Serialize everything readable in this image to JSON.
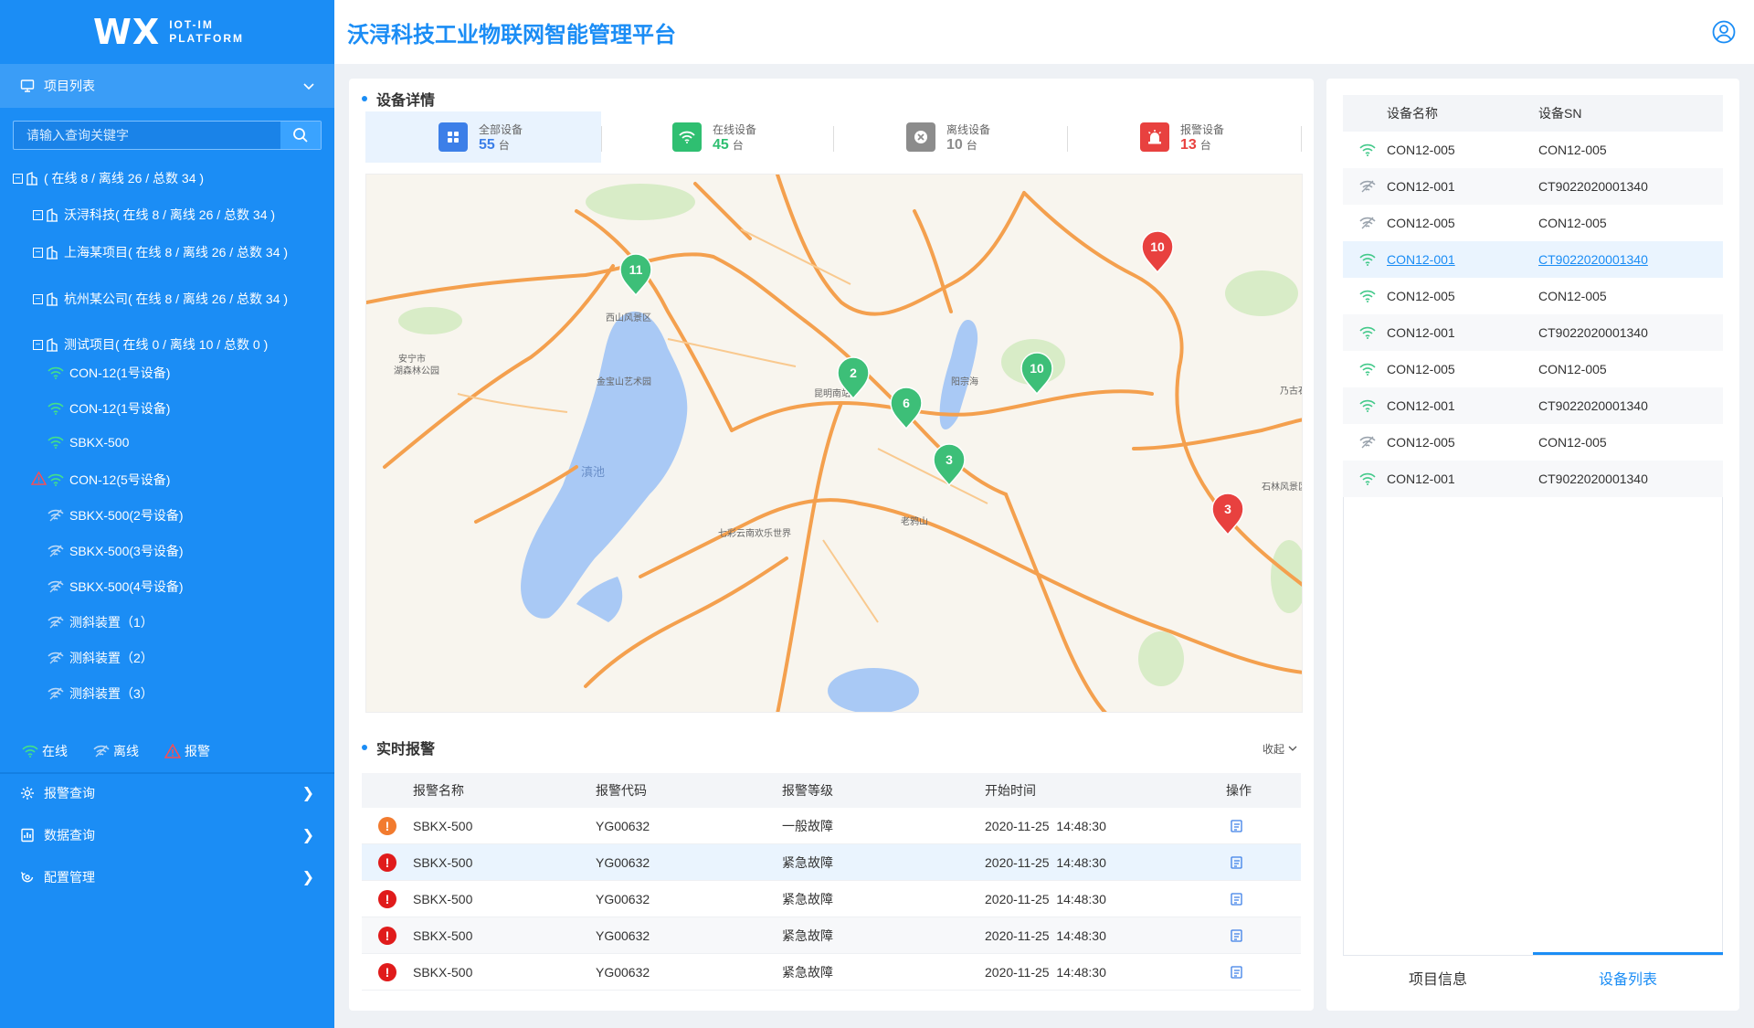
{
  "brand": {
    "logo": "WX",
    "sub_line1": "IOT-IM",
    "sub_line2": "PLATFORM"
  },
  "app_title": "沃浔科技工业物联网智能管理平台",
  "sidebar": {
    "project_menu": "项目列表",
    "search_placeholder": "请输入查询关键字",
    "tree": [
      {
        "label": "( 在线 8 / 离线 26 / 总数 34 )"
      },
      {
        "label": "沃浔科技( 在线 8 / 离线 26 / 总数 34 )"
      },
      {
        "label": "上海某项目( 在线 8 / 离线 26 / 总数 34 )"
      },
      {
        "label": "杭州某公司( 在线 8 / 离线 26 / 总数 34 )"
      },
      {
        "label": "测试项目( 在线 0 / 离线 10 / 总数 0 )"
      }
    ],
    "devices": [
      {
        "label": "CON-12(1号设备)",
        "status": "online",
        "alarm": false
      },
      {
        "label": "CON-12(1号设备)",
        "status": "online",
        "alarm": false
      },
      {
        "label": "SBKX-500",
        "status": "online",
        "alarm": false
      },
      {
        "label": "CON-12(5号设备)",
        "status": "online",
        "alarm": true
      },
      {
        "label": "SBKX-500(2号设备)",
        "status": "offline",
        "alarm": false
      },
      {
        "label": "SBKX-500(3号设备)",
        "status": "offline",
        "alarm": false
      },
      {
        "label": "SBKX-500(4号设备)",
        "status": "offline",
        "alarm": false
      },
      {
        "label": "测斜装置（1）",
        "status": "offline",
        "alarm": false
      },
      {
        "label": "测斜装置（2）",
        "status": "offline",
        "alarm": false
      },
      {
        "label": "测斜装置（3）",
        "status": "offline",
        "alarm": false
      }
    ],
    "legend": {
      "online": "在线",
      "offline": "离线",
      "alarm": "报警"
    },
    "nav": [
      {
        "label": "报警查询"
      },
      {
        "label": "数据查询"
      },
      {
        "label": "配置管理"
      }
    ]
  },
  "device_detail": {
    "title": "设备详情",
    "stats": [
      {
        "label": "全部设备",
        "value": "55",
        "unit": "台",
        "color": "#3c7fe8"
      },
      {
        "label": "在线设备",
        "value": "45",
        "unit": "台",
        "color": "#2fbf71"
      },
      {
        "label": "离线设备",
        "value": "10",
        "unit": "台",
        "color": "#8c8c8c"
      },
      {
        "label": "报警设备",
        "value": "13",
        "unit": "台",
        "color": "#e8413f"
      }
    ]
  },
  "map": {
    "places": [
      "安宁市",
      "湖森林公园",
      "金宝山艺术园",
      "西山风景区",
      "昆明南站",
      "阳宗海",
      "乃古石",
      "石林风景区",
      "七彩云南欢乐世界",
      "老鸦山",
      "滇池"
    ],
    "markers": [
      {
        "count": "11",
        "status": "online"
      },
      {
        "count": "10",
        "status": "alarm"
      },
      {
        "count": "10",
        "status": "online"
      },
      {
        "count": "2",
        "status": "online"
      },
      {
        "count": "6",
        "status": "online"
      },
      {
        "count": "3",
        "status": "online"
      },
      {
        "count": "3",
        "status": "alarm"
      }
    ]
  },
  "alarms": {
    "title": "实时报警",
    "collapse": "收起",
    "headers": [
      "报警名称",
      "报警代码",
      "报警等级",
      "开始时间",
      "操作"
    ],
    "rows": [
      {
        "name": "SBKX-500",
        "code": "YG00632",
        "level": "一般故障",
        "time": "2020-11-25  14:48:30",
        "severity": "normal"
      },
      {
        "name": "SBKX-500",
        "code": "YG00632",
        "level": "紧急故障",
        "time": "2020-11-25  14:48:30",
        "severity": "urgent"
      },
      {
        "name": "SBKX-500",
        "code": "YG00632",
        "level": "紧急故障",
        "time": "2020-11-25  14:48:30",
        "severity": "urgent"
      },
      {
        "name": "SBKX-500",
        "code": "YG00632",
        "level": "紧急故障",
        "time": "2020-11-25  14:48:30",
        "severity": "urgent"
      },
      {
        "name": "SBKX-500",
        "code": "YG00632",
        "level": "紧急故障",
        "time": "2020-11-25  14:48:30",
        "severity": "urgent"
      }
    ]
  },
  "device_list": {
    "headers": [
      "设备名称",
      "设备SN"
    ],
    "rows": [
      {
        "name": "CON12-005",
        "sn": "CON12-005",
        "online": true
      },
      {
        "name": "CON12-001",
        "sn": "CT9022020001340",
        "online": false
      },
      {
        "name": "CON12-005",
        "sn": "CON12-005",
        "online": false
      },
      {
        "name": "CON12-001",
        "sn": "CT9022020001340",
        "online": true,
        "selected": true
      },
      {
        "name": "CON12-005",
        "sn": "CON12-005",
        "online": true
      },
      {
        "name": "CON12-001",
        "sn": "CT9022020001340",
        "online": true
      },
      {
        "name": "CON12-005",
        "sn": "CON12-005",
        "online": true
      },
      {
        "name": "CON12-001",
        "sn": "CT9022020001340",
        "online": true
      },
      {
        "name": "CON12-005",
        "sn": "CON12-005",
        "online": false
      },
      {
        "name": "CON12-001",
        "sn": "CT9022020001340",
        "online": true
      }
    ],
    "tabs": [
      "项目信息",
      "设备列表"
    ],
    "active_tab": "设备列表"
  }
}
